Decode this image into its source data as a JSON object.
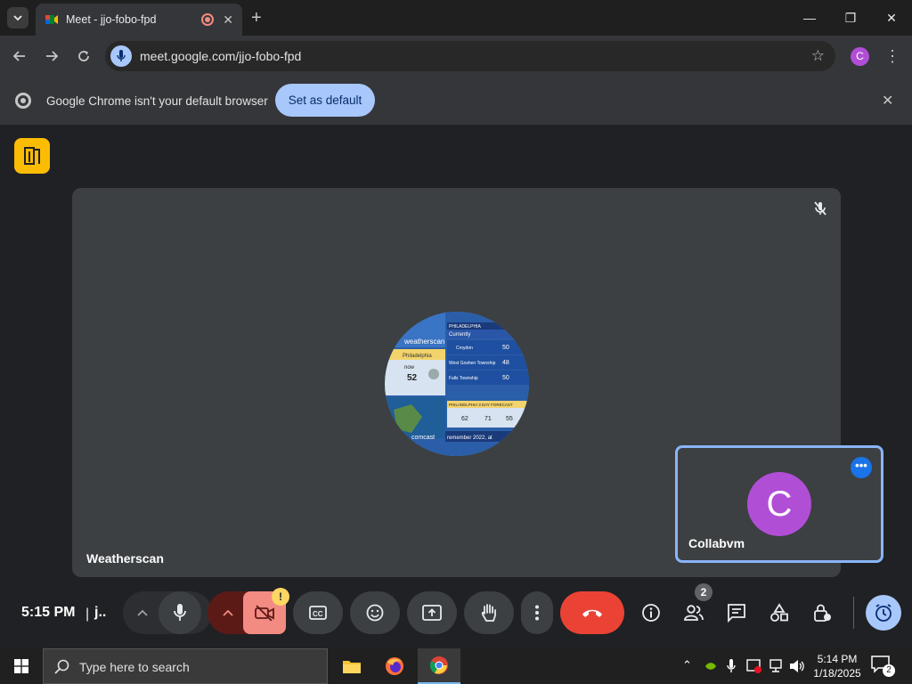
{
  "browser": {
    "tab_title": "Meet - jjo-fobo-fpd",
    "tab_close": "✕",
    "new_tab": "+",
    "url": "meet.google.com/jjo-fobo-fpd",
    "profile_initial": "C",
    "window_controls": [
      "—",
      "❐",
      "✕"
    ]
  },
  "infobar": {
    "message": "Google Chrome isn't your default browser",
    "button": "Set as default"
  },
  "meet": {
    "main_participant": "Weatherscan",
    "self_participant": "Collabvm",
    "self_initial": "C",
    "clock": "5:15 PM",
    "separator": "|",
    "meeting_code_short": "j..",
    "people_count": "2",
    "warning_badge": "!",
    "more_dots": "•••"
  },
  "weather_avatar": {
    "brand": "weatherscan",
    "city": "Philadelphia",
    "now_label": "now",
    "temp": "52",
    "header": "PHILADELPHIA",
    "currently": "Currently",
    "rows": [
      {
        "name": "Croydon",
        "temp": "50"
      },
      {
        "name": "West Goshen Township",
        "temp": "48"
      },
      {
        "name": "Falls Township",
        "temp": "50"
      }
    ],
    "forecast_header": "PHILADELPHIA  3 DAY FORECAST",
    "forecast": [
      "62",
      "71",
      "55"
    ],
    "provider": "comcast",
    "ticker": "remember 2022, at"
  },
  "taskbar": {
    "search_placeholder": "Type here to search",
    "time": "5:14 PM",
    "date": "1/18/2025",
    "notif_count": "2"
  },
  "colors": {
    "end_call": "#ea4335",
    "accent": "#8ab4f8",
    "avatar_purple": "#b14ed6",
    "camera_off_bg": "#f28b82"
  }
}
